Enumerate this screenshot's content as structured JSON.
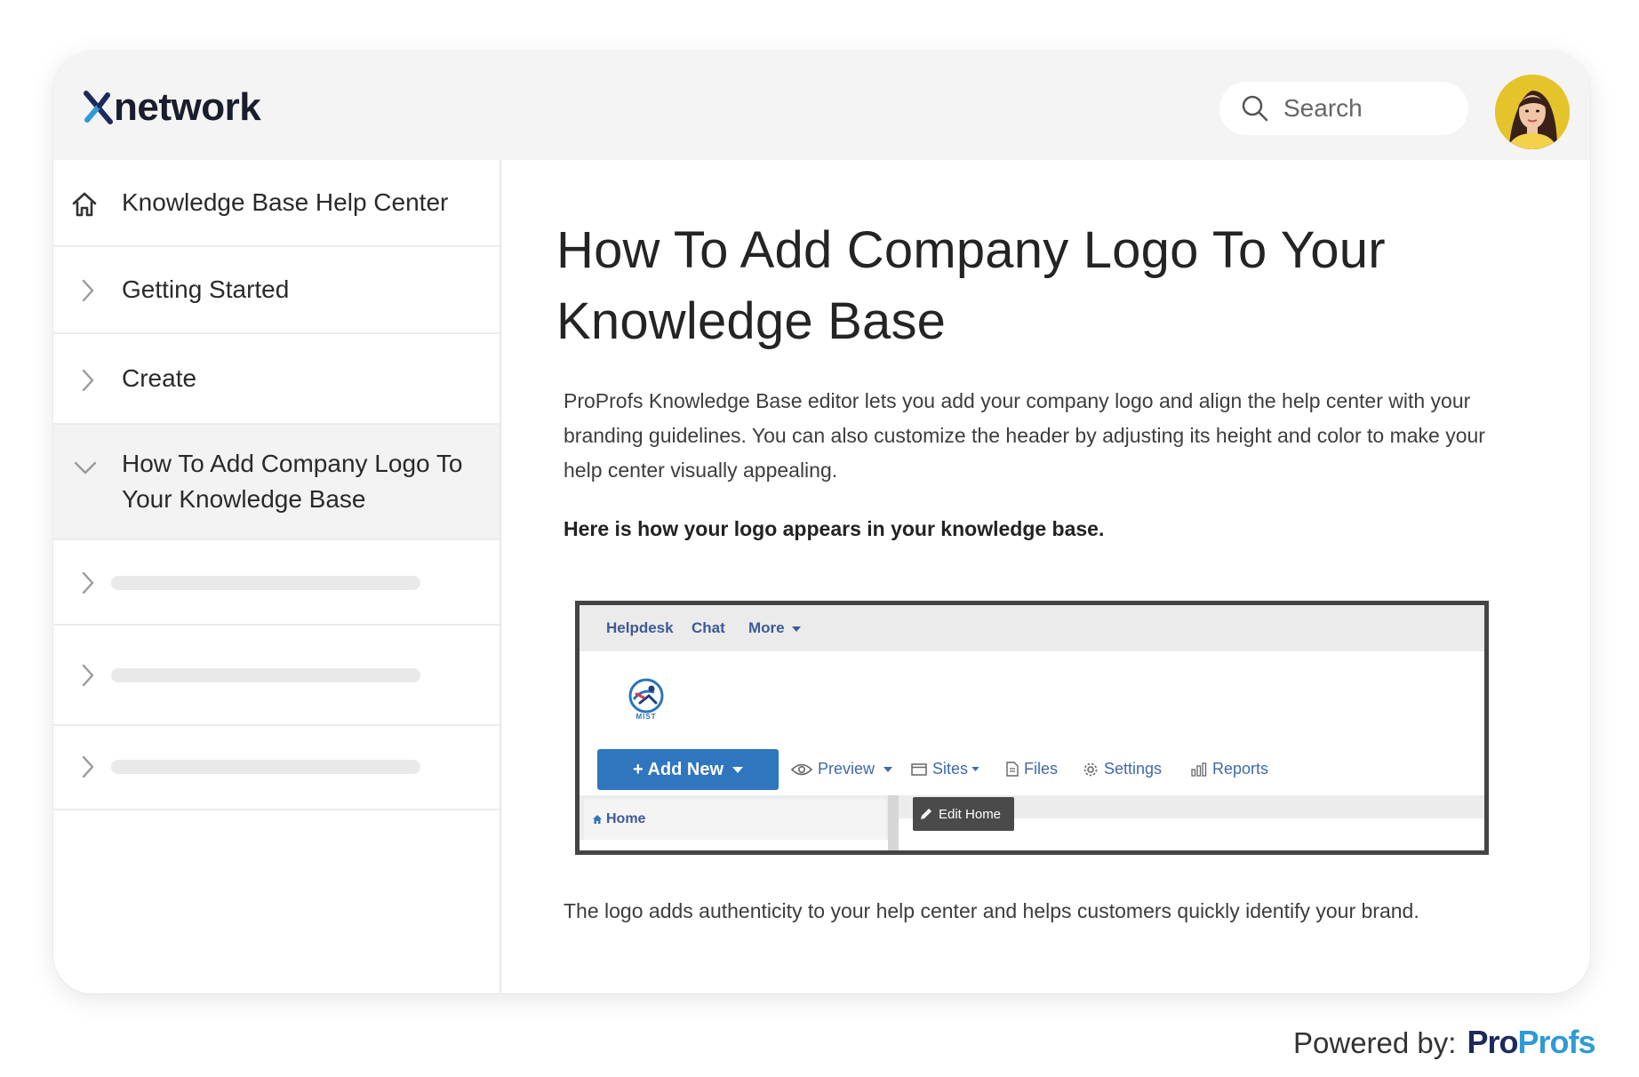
{
  "header": {
    "brand": "network",
    "search_placeholder": "Search",
    "avatar_alt": "user avatar"
  },
  "sidebar": {
    "home_label": "Knowledge Base Help Center",
    "items": [
      {
        "label": "Getting Started"
      },
      {
        "label": "Create"
      },
      {
        "label": "How To Add Company Logo To Your Knowledge Base",
        "expanded": true
      }
    ]
  },
  "article": {
    "title": "How To Add Company Logo To Your Knowledge Base",
    "intro": "ProProfs Knowledge Base editor lets you add your company logo and align the help center with your branding guidelines. You can also customize the header by adjusting its height and color to make your help center visually appealing.",
    "subheading": "Here is how your logo appears in your knowledge base.",
    "outro": "The logo adds authenticity to your help center and helps customers quickly identify your brand."
  },
  "screenshot": {
    "nav": [
      "Helpdesk",
      "Chat",
      "More"
    ],
    "logo_text": "MIST",
    "add_new": "+ Add New",
    "tools": [
      "Preview",
      "Sites",
      "Files",
      "Settings",
      "Reports"
    ],
    "home": "Home",
    "edit_home": "Edit Home"
  },
  "footer": {
    "powered_by": "Powered by:",
    "brand_pro": "Pro",
    "brand_profs": "Profs"
  },
  "colors": {
    "accent_dark": "#1d2a5b",
    "accent_blue": "#2e9bd6",
    "button_blue": "#2f76be"
  }
}
